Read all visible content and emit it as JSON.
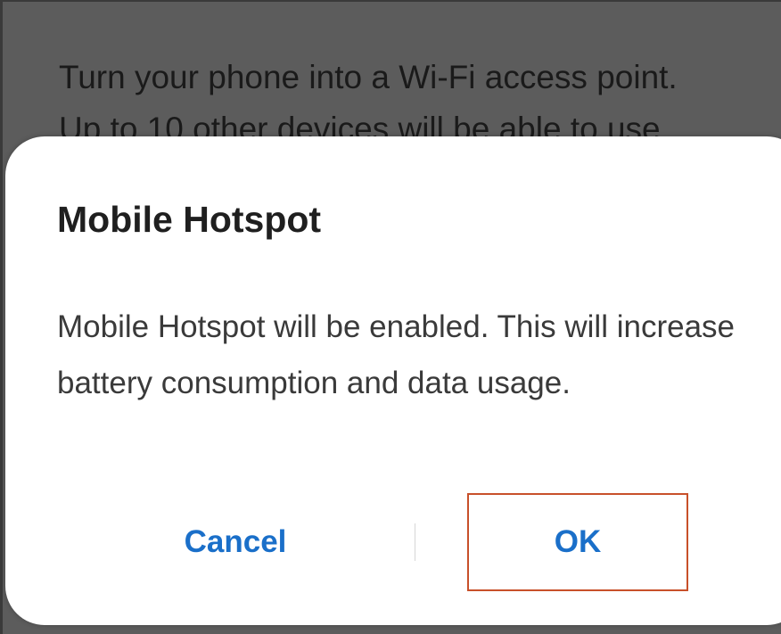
{
  "background": {
    "lines": [
      "Turn your phone into a Wi-Fi access point.",
      "Up to 10 other devices will be able to use"
    ]
  },
  "dialog": {
    "title": "Mobile Hotspot",
    "message": "Mobile Hotspot will be enabled. This will increase battery consumption and data usage.",
    "cancel_label": "Cancel",
    "ok_label": "OK"
  },
  "colors": {
    "button_text": "#1a6fc9",
    "highlight_border": "#c8502a",
    "backdrop": "#5c5c5c"
  }
}
